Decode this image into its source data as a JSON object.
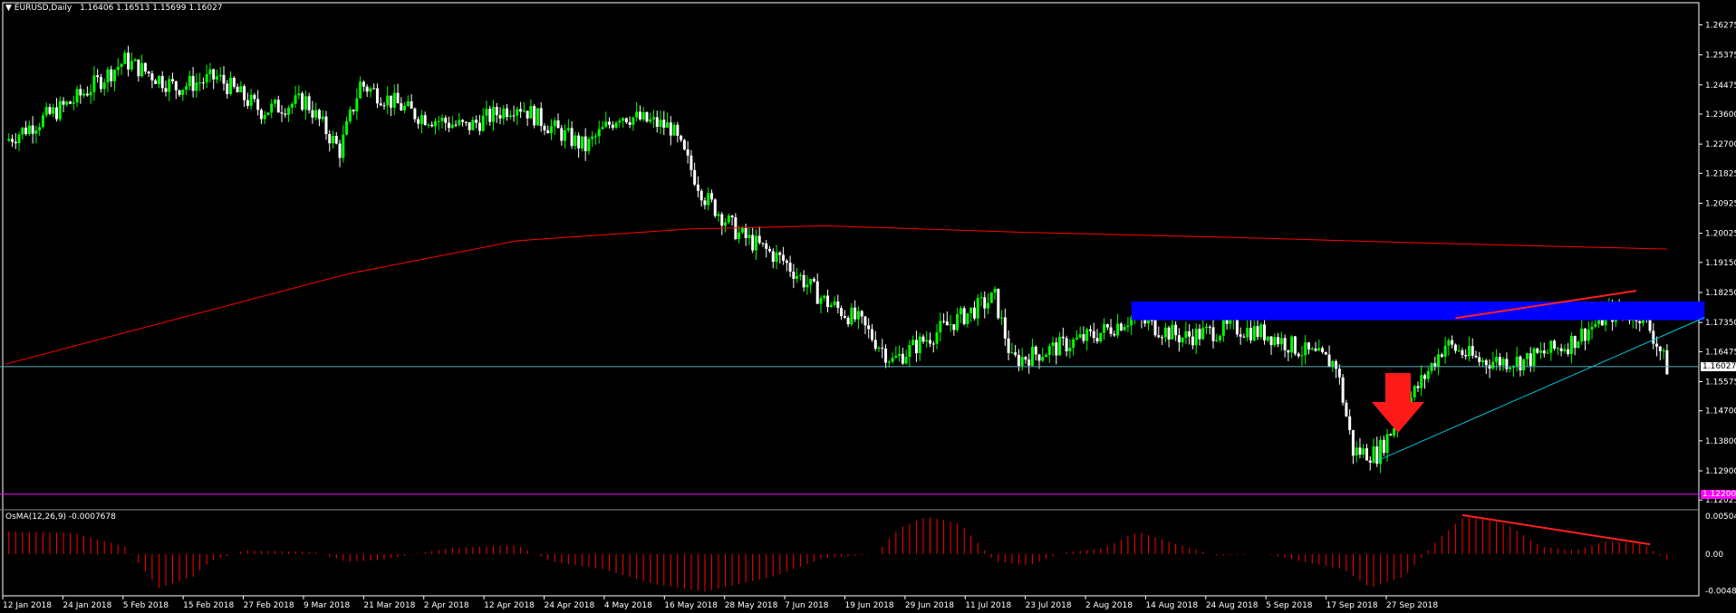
{
  "chart": {
    "symbol_label": "EURUSD,Daily",
    "ohlc_label": "1.16406 1.16513 1.15699 1.16027",
    "current_price_tag": "1.16027",
    "support_price_tag": "1.12200",
    "indicator_label": "OsMA(12,26,9) -0.0007678",
    "colors": {
      "background": "#000000",
      "bull_candle": "#00ff00",
      "bear_candle": "#ffffff",
      "moving_average": "#ff0000",
      "resistance_zone": "#0000ff",
      "trendline": "#00c8e0",
      "divergence_line": "#ff2020",
      "arrow": "#ff1a1a",
      "support_line": "#ff00ff",
      "osma_bars": "#ff0000"
    },
    "icons": {
      "menu": "triangle-down-icon",
      "signal": "red-down-arrow-icon"
    }
  },
  "chart_data": {
    "type": "candlestick",
    "price_axis_labels": [
      "1.26275",
      "1.25375",
      "1.24475",
      "1.23600",
      "1.22700",
      "1.21825",
      "1.20925",
      "1.20025",
      "1.19150",
      "1.18250",
      "1.17350",
      "1.16475",
      "1.15575",
      "1.14700",
      "1.13800",
      "1.12900",
      "1.12025"
    ],
    "osma_axis_labels": [
      "0.005044",
      "0.00",
      "-0.004877"
    ],
    "x_axis_labels": [
      "12 Jan 2018",
      "24 Jan 2018",
      "5 Feb 2018",
      "15 Feb 2018",
      "27 Feb 2018",
      "9 Mar 2018",
      "21 Mar 2018",
      "2 Apr 2018",
      "12 Apr 2018",
      "24 Apr 2018",
      "4 May 2018",
      "16 May 2018",
      "28 May 2018",
      "7 Jun 2018",
      "19 Jun 2018",
      "29 Jun 2018",
      "11 Jul 2018",
      "23 Jul 2018",
      "2 Aug 2018",
      "14 Aug 2018",
      "24 Aug 2018",
      "5 Sep 2018",
      "17 Sep 2018",
      "27 Sep 2018"
    ],
    "price_range": [
      1.1195,
      1.2675
    ],
    "osma_range": [
      -0.0052,
      0.0053
    ],
    "close_path": [
      [
        0,
        1.228
      ],
      [
        20,
        1.24
      ],
      [
        35,
        1.252
      ],
      [
        50,
        1.244
      ],
      [
        62,
        1.247
      ],
      [
        75,
        1.237
      ],
      [
        88,
        1.24
      ],
      [
        98,
        1.225
      ],
      [
        104,
        1.245
      ],
      [
        120,
        1.236
      ],
      [
        135,
        1.232
      ],
      [
        150,
        1.239
      ],
      [
        160,
        1.232
      ],
      [
        170,
        1.226
      ],
      [
        180,
        1.236
      ],
      [
        195,
        1.232
      ],
      [
        205,
        1.211
      ],
      [
        215,
        1.2
      ],
      [
        228,
        1.192
      ],
      [
        240,
        1.18
      ],
      [
        250,
        1.174
      ],
      [
        260,
        1.162
      ],
      [
        275,
        1.172
      ],
      [
        290,
        1.181
      ],
      [
        295,
        1.162
      ],
      [
        305,
        1.165
      ],
      [
        320,
        1.17
      ],
      [
        330,
        1.175
      ],
      [
        345,
        1.169
      ],
      [
        360,
        1.172
      ],
      [
        370,
        1.17
      ],
      [
        380,
        1.165
      ],
      [
        390,
        1.161
      ],
      [
        395,
        1.135
      ],
      [
        402,
        1.134
      ],
      [
        412,
        1.151
      ],
      [
        422,
        1.167
      ],
      [
        432,
        1.162
      ],
      [
        445,
        1.162
      ],
      [
        458,
        1.167
      ],
      [
        470,
        1.176
      ],
      [
        480,
        1.176
      ],
      [
        485,
        1.165
      ],
      [
        487,
        1.16
      ]
    ],
    "ma_path": [
      [
        0,
        1.161
      ],
      [
        100,
        1.188
      ],
      [
        150,
        1.198
      ],
      [
        200,
        1.2015
      ],
      [
        240,
        1.2025
      ],
      [
        300,
        1.2005
      ],
      [
        360,
        1.199
      ],
      [
        410,
        1.1975
      ],
      [
        487,
        1.1955
      ]
    ],
    "resistance_zone": {
      "low": 1.1742,
      "high": 1.1798,
      "from_bar": 330,
      "to_bar": 498
    },
    "trendline": {
      "from": [
        402,
        1.132
      ],
      "to": [
        498,
        1.175
      ]
    },
    "divergence_price": {
      "from": [
        425,
        1.1748
      ],
      "to": [
        478,
        1.183
      ]
    },
    "divergence_osma": {
      "from": [
        427,
        0.0052
      ],
      "to": [
        482,
        0.0013
      ]
    },
    "current_price": 1.16027,
    "support_price": 1.122,
    "osma_path": [
      [
        0,
        0.003
      ],
      [
        20,
        0.0028
      ],
      [
        35,
        0.001
      ],
      [
        45,
        -0.0045
      ],
      [
        55,
        -0.003
      ],
      [
        60,
        -0.001
      ],
      [
        70,
        0.0005
      ],
      [
        90,
        0.0003
      ],
      [
        100,
        -0.001
      ],
      [
        110,
        -0.0008
      ],
      [
        130,
        0.0008
      ],
      [
        150,
        0.0012
      ],
      [
        160,
        -0.001
      ],
      [
        175,
        -0.002
      ],
      [
        190,
        -0.004
      ],
      [
        205,
        -0.005
      ],
      [
        215,
        -0.004
      ],
      [
        225,
        -0.003
      ],
      [
        240,
        -0.0005
      ],
      [
        255,
        0.0
      ],
      [
        262,
        0.0035
      ],
      [
        270,
        0.005
      ],
      [
        280,
        0.004
      ],
      [
        290,
        -0.001
      ],
      [
        300,
        -0.0015
      ],
      [
        310,
        0.0002
      ],
      [
        322,
        0.0008
      ],
      [
        332,
        0.003
      ],
      [
        342,
        0.0015
      ],
      [
        355,
        -0.0002
      ],
      [
        370,
        0.0
      ],
      [
        380,
        -0.001
      ],
      [
        392,
        -0.002
      ],
      [
        400,
        -0.0045
      ],
      [
        410,
        -0.003
      ],
      [
        420,
        0.002
      ],
      [
        428,
        0.0052
      ],
      [
        440,
        0.004
      ],
      [
        450,
        0.001
      ],
      [
        460,
        0.0005
      ],
      [
        470,
        0.0018
      ],
      [
        480,
        0.0013
      ],
      [
        487,
        -0.0008
      ]
    ]
  }
}
